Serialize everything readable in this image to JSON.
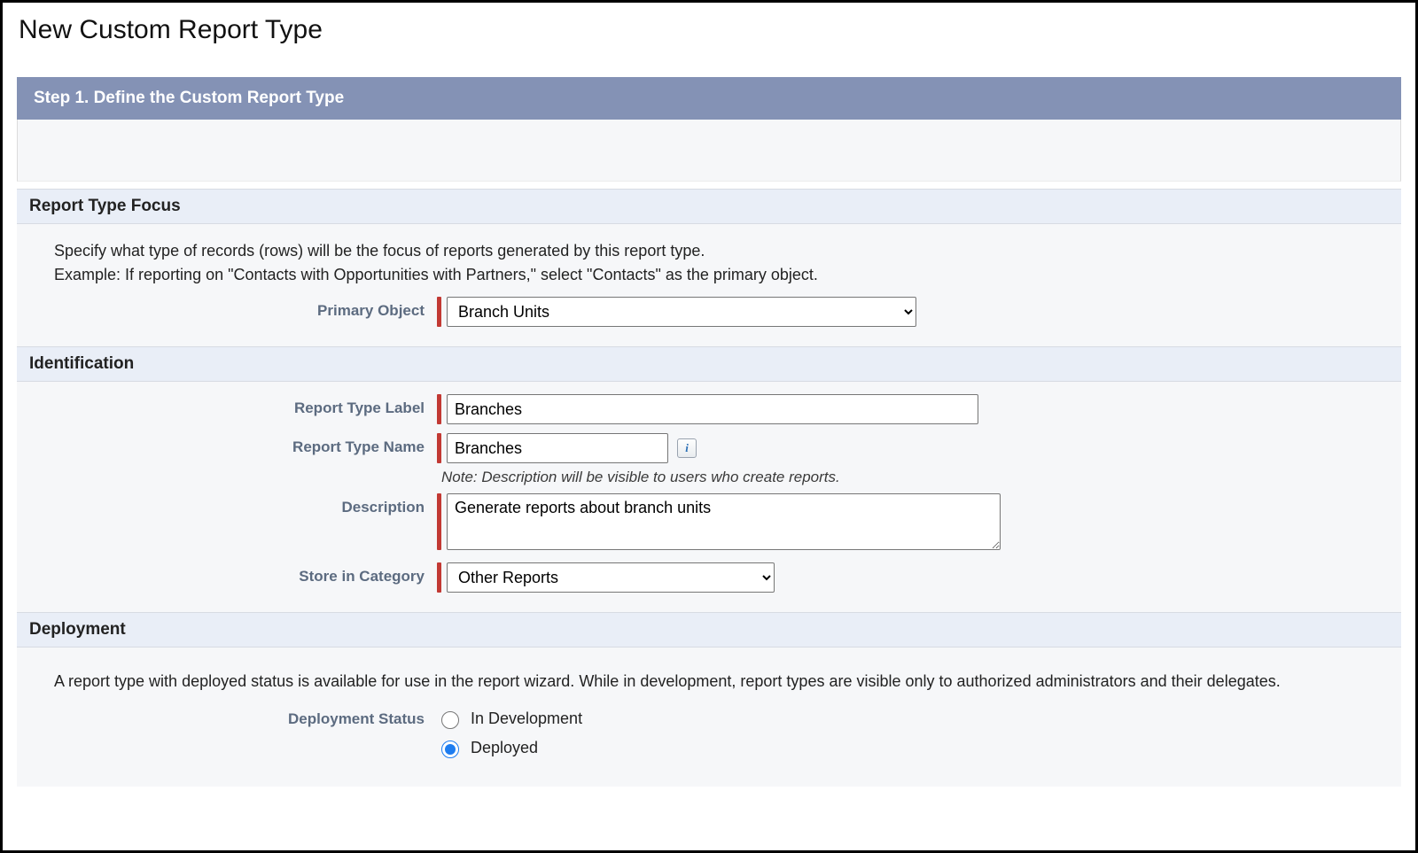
{
  "page_title": "New Custom Report Type",
  "step_header": "Step 1. Define the Custom Report Type",
  "focus": {
    "heading": "Report Type Focus",
    "line1": "Specify what type of records (rows) will be the focus of reports generated by this report type.",
    "line2": "Example: If reporting on \"Contacts with Opportunities with Partners,\" select \"Contacts\" as the primary object.",
    "primary_object_label": "Primary Object",
    "primary_object_value": "Branch Units"
  },
  "identification": {
    "heading": "Identification",
    "report_type_label_label": "Report Type Label",
    "report_type_label_value": "Branches",
    "report_type_name_label": "Report Type Name",
    "report_type_name_value": "Branches",
    "info_icon_text": "i",
    "note": "Note: Description will be visible to users who create reports.",
    "description_label": "Description",
    "description_value": "Generate reports about branch units",
    "category_label": "Store in Category",
    "category_value": "Other Reports"
  },
  "deployment": {
    "heading": "Deployment",
    "help": "A report type with deployed status is available for use in the report wizard. While in development, report types are visible only to authorized administrators and their delegates.",
    "status_label": "Deployment Status",
    "option_in_development": "In Development",
    "option_deployed": "Deployed"
  }
}
